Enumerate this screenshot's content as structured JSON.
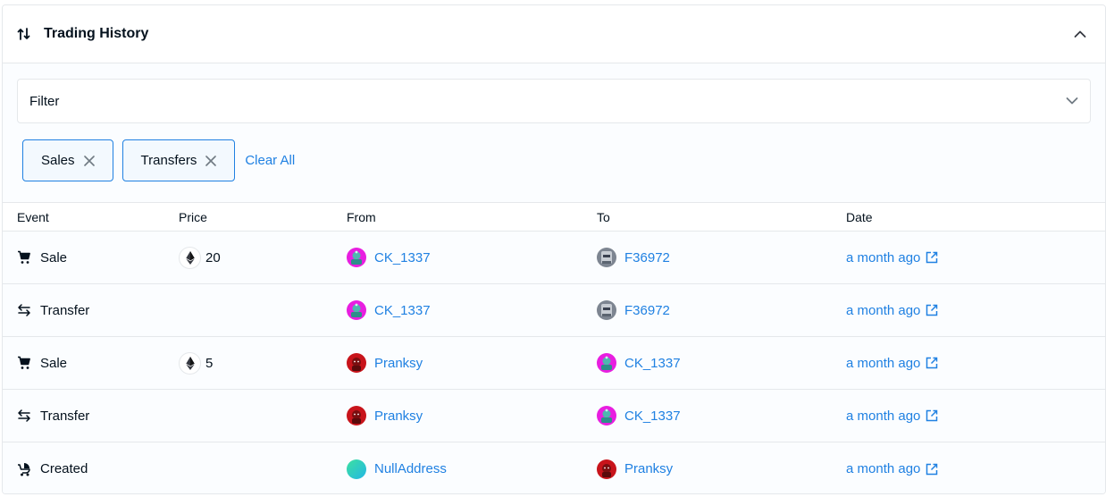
{
  "header": {
    "title": "Trading History",
    "icon": "swap-vertical-icon"
  },
  "filter": {
    "label": "Filter",
    "chips": [
      {
        "label": "Sales"
      },
      {
        "label": "Transfers"
      }
    ],
    "clear_all": "Clear All"
  },
  "table": {
    "columns": {
      "event": "Event",
      "price": "Price",
      "from": "From",
      "to": "To",
      "date": "Date"
    },
    "rows": [
      {
        "event": "Sale",
        "event_icon": "cart-icon",
        "price": "20",
        "from": "CK_1337",
        "to": "F36972",
        "date": "a month ago"
      },
      {
        "event": "Transfer",
        "event_icon": "transfer-icon",
        "price": "",
        "from": "CK_1337",
        "to": "F36972",
        "date": "a month ago"
      },
      {
        "event": "Sale",
        "event_icon": "cart-icon",
        "price": "5",
        "from": "Pranksy",
        "to": "CK_1337",
        "date": "a month ago"
      },
      {
        "event": "Transfer",
        "event_icon": "transfer-icon",
        "price": "",
        "from": "Pranksy",
        "to": "CK_1337",
        "date": "a month ago"
      },
      {
        "event": "Created",
        "event_icon": "stroller-icon",
        "price": "",
        "from": "NullAddress",
        "to": "Pranksy",
        "date": "a month ago"
      }
    ]
  },
  "colors": {
    "link": "#2081e2",
    "text": "#04111d",
    "border": "#e5e8eb",
    "chip_border": "#2081e2"
  }
}
